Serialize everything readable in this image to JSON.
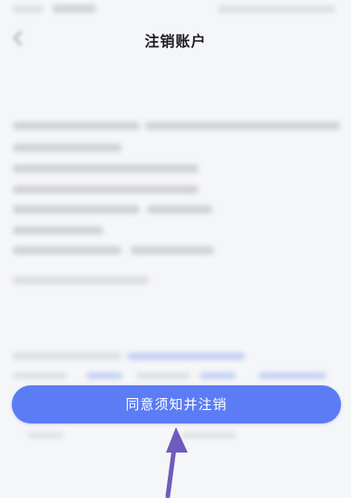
{
  "header": {
    "title": "注销账户"
  },
  "footer": {
    "confirm_label": "同意须知并注销"
  },
  "icons": {
    "back": "chevron-left-icon",
    "annotation": "arrow-up-icon"
  },
  "colors": {
    "accent": "#5b7cf5",
    "arrow": "#6e5bbd",
    "background": "#f5f6f8"
  }
}
